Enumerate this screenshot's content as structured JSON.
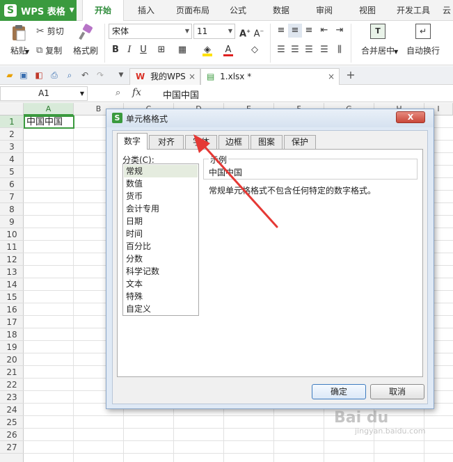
{
  "app": {
    "title": "WPS 表格",
    "logo_letter": "S"
  },
  "ribbon_tabs": [
    "开始",
    "插入",
    "页面布局",
    "公式",
    "数据",
    "审阅",
    "视图",
    "开发工具",
    "云"
  ],
  "ribbon": {
    "paste_label": "粘贴",
    "cut_label": "剪切",
    "copy_label": "复制",
    "format_painter_label": "格式刷",
    "font_name": "宋体",
    "font_size": "11",
    "merge_center_label": "合并居中",
    "wrap_text_label": "自动换行",
    "merge_icon_letter": "T"
  },
  "doc_tabs": [
    {
      "label": "我的WPS",
      "brand_letter": "W"
    },
    {
      "label": "1.xlsx *"
    }
  ],
  "formula_bar": {
    "name_box": "A1",
    "fx": "fx",
    "content": "中国中国"
  },
  "sheet": {
    "columns": [
      "A",
      "B",
      "C",
      "D",
      "E",
      "F",
      "G",
      "H",
      "I"
    ],
    "rows": [
      "1",
      "2",
      "3",
      "4",
      "5",
      "6",
      "7",
      "8",
      "9",
      "10",
      "11",
      "12",
      "13",
      "14",
      "15",
      "16",
      "17",
      "18",
      "19",
      "20",
      "21",
      "22",
      "23",
      "24",
      "25",
      "26",
      "27"
    ],
    "a1_value": "中国中国"
  },
  "dialog": {
    "title": "单元格格式",
    "close_label": "X",
    "tabs": [
      "数字",
      "对齐",
      "字体",
      "边框",
      "图案",
      "保护"
    ],
    "active_tab": "数字",
    "category_label": "分类(C):",
    "categories": [
      "常规",
      "数值",
      "货币",
      "会计专用",
      "日期",
      "时间",
      "百分比",
      "分数",
      "科学记数",
      "文本",
      "特殊",
      "自定义"
    ],
    "selected_category": "常规",
    "sample_legend": "示例",
    "sample_value": "中国中国",
    "description": "常规单元格格式不包含任何特定的数字格式。",
    "ok_label": "确定",
    "cancel_label": "取消"
  },
  "watermark": {
    "text": "Bai du",
    "sub": "jingyan.baidu.com"
  },
  "colors": {
    "accent_green": "#3a9a3e",
    "arrow_red": "#e53935"
  }
}
